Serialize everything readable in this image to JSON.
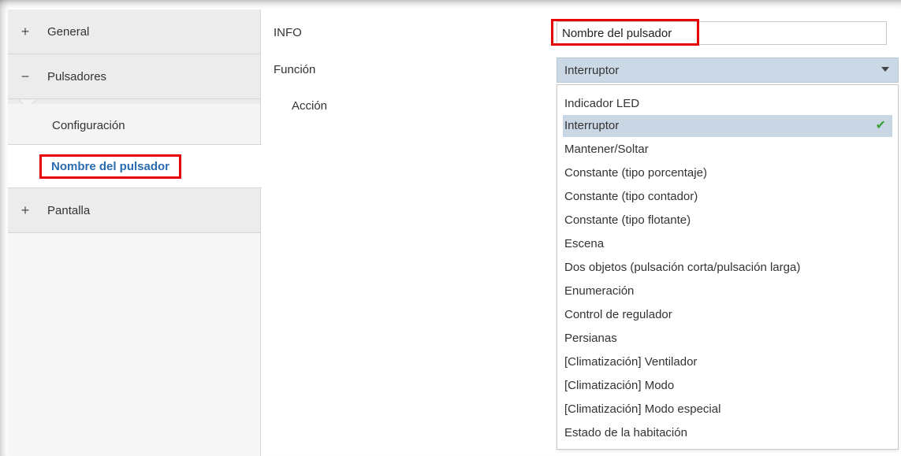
{
  "sidebar": {
    "items": [
      {
        "sign": "+",
        "label": "General"
      },
      {
        "sign": "−",
        "label": "Pulsadores"
      },
      {
        "label": "Configuración"
      },
      {
        "label": "Nombre del pulsador"
      },
      {
        "sign": "+",
        "label": "Pantalla"
      }
    ]
  },
  "main": {
    "info_label": "INFO",
    "info_value": "Nombre del pulsador",
    "funcion_label": "Función",
    "accion_label": "Acción",
    "funcion_selected": "Interruptor",
    "options": [
      "Indicador LED",
      "Interruptor",
      "Mantener/Soltar",
      "Constante (tipo porcentaje)",
      "Constante (tipo contador)",
      "Constante (tipo flotante)",
      "Escena",
      "Dos objetos (pulsación corta/pulsación larga)",
      "Enumeración",
      "Control de regulador",
      "Persianas",
      "[Climatización] Ventilador",
      "[Climatización] Modo",
      "[Climatización] Modo especial",
      "Estado de la habitación"
    ],
    "selected_index": 1
  },
  "colors": {
    "highlight": "#e60000",
    "active_link": "#2b6cb0",
    "select_bg": "#cbd9e6",
    "check": "#3aa03a"
  }
}
